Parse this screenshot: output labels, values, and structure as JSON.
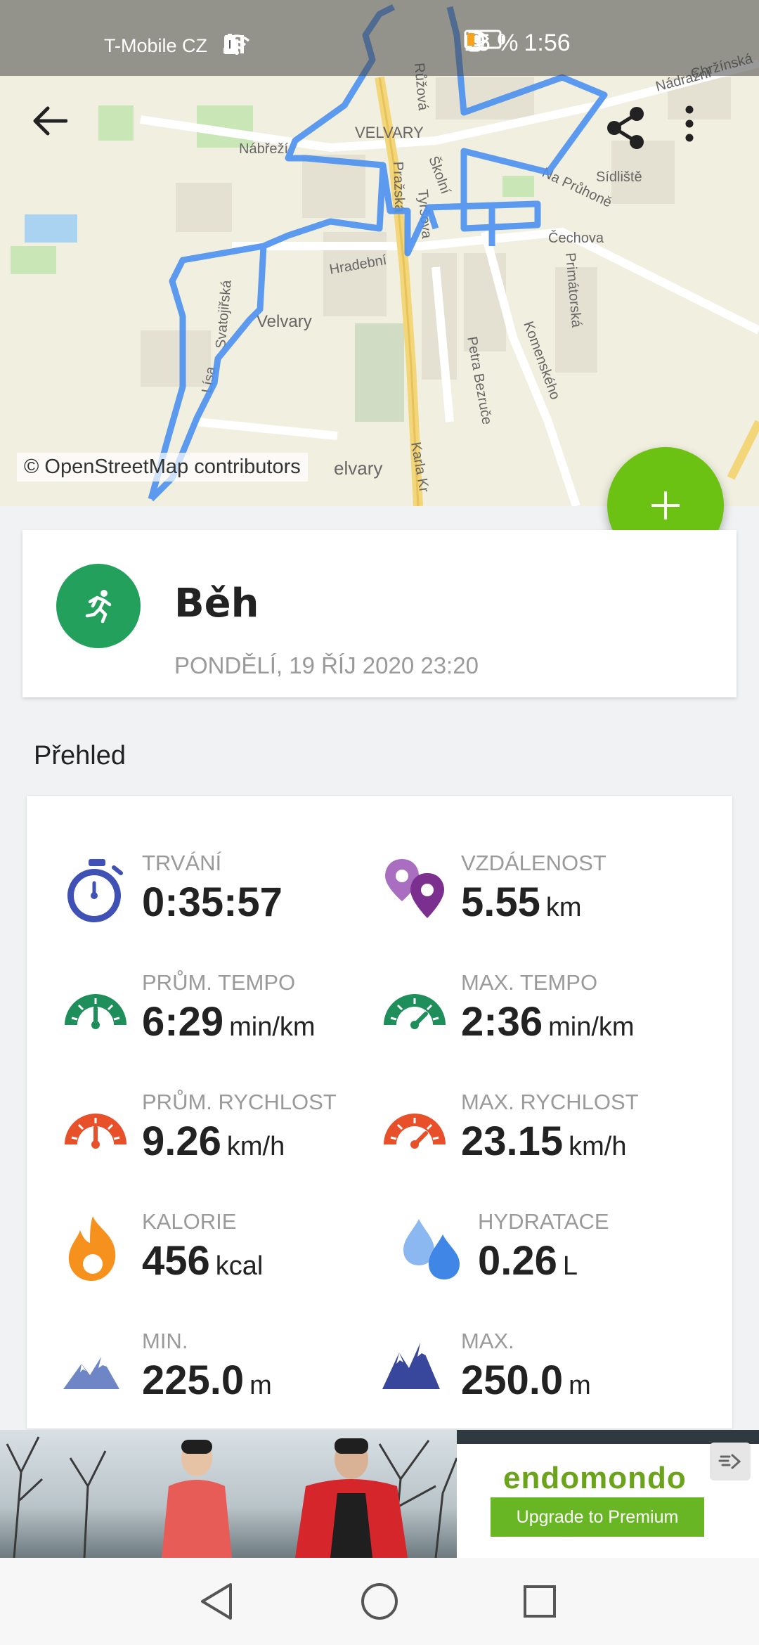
{
  "status_bar": {
    "carrier": "T-Mobile CZ",
    "battery": "15 %",
    "time": "1:56"
  },
  "map": {
    "labels": [
      "VELVARY",
      "Velvary",
      "Nábřeží",
      "Pražská",
      "Školní",
      "Tyršova",
      "Hradební",
      "Svatojiřská",
      "Lísa",
      "Čechova",
      "Primátorská",
      "Komenského",
      "Petra Bezruče",
      "Na Průhoně",
      "Sídliště",
      "Nádražní",
      "Chržínská",
      "Růžová",
      "Karla Kr",
      "elvary"
    ],
    "credit": "© OpenStreetMap contributors"
  },
  "toolbar": {
    "back_icon": "arrow-left-icon",
    "share_icon": "share-icon",
    "menu_icon": "more-vert-icon"
  },
  "activity": {
    "name": "Běh",
    "date": "PONDĚLÍ, 19 ŘÍJ 2020 23:20",
    "icon": "running-icon"
  },
  "overview": {
    "title": "Přehled",
    "stats": [
      {
        "label": "TRVÁNÍ",
        "value": "0:35:57",
        "unit": "",
        "icon": "stopwatch-icon",
        "color": "#3f51b5"
      },
      {
        "label": "VZDÁLENOST",
        "value": "5.55",
        "unit": "km",
        "icon": "location-pins-icon",
        "color": "#8e3fa6"
      },
      {
        "label": "PRŮM. TEMPO",
        "value": "6:29",
        "unit": "min/km",
        "icon": "speedometer-icon",
        "color": "#1e8e5a"
      },
      {
        "label": "MAX. TEMPO",
        "value": "2:36",
        "unit": "min/km",
        "icon": "speedometer-icon",
        "color": "#1e8e5a"
      },
      {
        "label": "PRŮM. RYCHLOST",
        "value": "9.26",
        "unit": "km/h",
        "icon": "speedometer-icon",
        "color": "#e8502a"
      },
      {
        "label": "MAX. RYCHLOST",
        "value": "23.15",
        "unit": "km/h",
        "icon": "speedometer-icon",
        "color": "#e8502a"
      },
      {
        "label": "KALORIE",
        "value": "456",
        "unit": "kcal",
        "icon": "flame-icon",
        "color": "#f7911e"
      },
      {
        "label": "HYDRATACE",
        "value": "0.26",
        "unit": "L",
        "icon": "water-drops-icon",
        "color": "#4a8fe7"
      },
      {
        "label": "MIN.",
        "value": "225.0",
        "unit": "m",
        "icon": "mountain-icon",
        "color": "#6f86c6"
      },
      {
        "label": "MAX.",
        "value": "250.0",
        "unit": "m",
        "icon": "mountain-icon",
        "color": "#38479b"
      }
    ]
  },
  "ad": {
    "brand": "endomondo",
    "button": "Upgrade to Premium"
  },
  "colors": {
    "accent": "#6cc212",
    "activity": "#22a05c",
    "route": "#4a90f0"
  }
}
